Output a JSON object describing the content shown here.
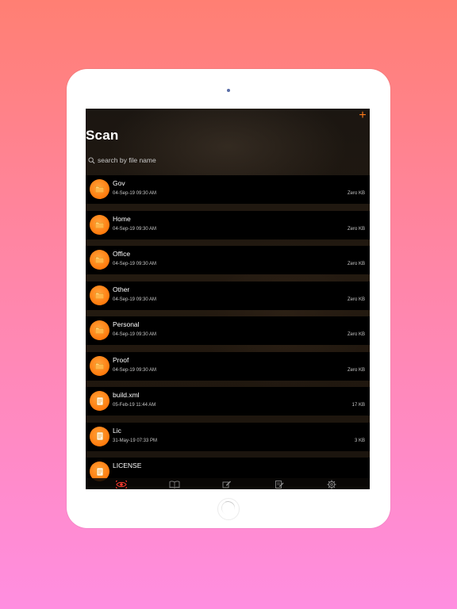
{
  "header": {
    "title": "Scan",
    "add_icon": "plus-icon"
  },
  "search": {
    "placeholder": "search by file name",
    "value": "",
    "icon": "search-icon"
  },
  "files": [
    {
      "name": "Gov",
      "date": "04-Sep-19 09:30 AM",
      "size": "Zero KB",
      "kind": "folder"
    },
    {
      "name": "Home",
      "date": "04-Sep-19 09:30 AM",
      "size": "Zero KB",
      "kind": "folder"
    },
    {
      "name": "Office",
      "date": "04-Sep-19 09:30 AM",
      "size": "Zero KB",
      "kind": "folder"
    },
    {
      "name": "Other",
      "date": "04-Sep-19 09:30 AM",
      "size": "Zero KB",
      "kind": "folder"
    },
    {
      "name": "Personal",
      "date": "04-Sep-19 09:30 AM",
      "size": "Zero KB",
      "kind": "folder"
    },
    {
      "name": "Proof",
      "date": "04-Sep-19 09:30 AM",
      "size": "Zero KB",
      "kind": "folder"
    },
    {
      "name": "build.xml",
      "date": "05-Feb-19 11:44 AM",
      "size": "17 KB",
      "kind": "document"
    },
    {
      "name": "Lic",
      "date": "31-May-19 07:33 PM",
      "size": "3 KB",
      "kind": "document"
    },
    {
      "name": "LICENSE",
      "date": "",
      "size": "",
      "kind": "document"
    }
  ],
  "tabs": [
    {
      "icon": "eye-scan-icon",
      "active": true
    },
    {
      "icon": "book-icon",
      "active": false
    },
    {
      "icon": "pen-edit-icon",
      "active": false
    },
    {
      "icon": "notepad-icon",
      "active": false
    },
    {
      "icon": "gear-icon",
      "active": false
    }
  ],
  "colors": {
    "accent": "#ff7a1a",
    "active_tab": "#ff3b30",
    "inactive_tab": "#8a8a8a",
    "row_bg": "#000000"
  }
}
